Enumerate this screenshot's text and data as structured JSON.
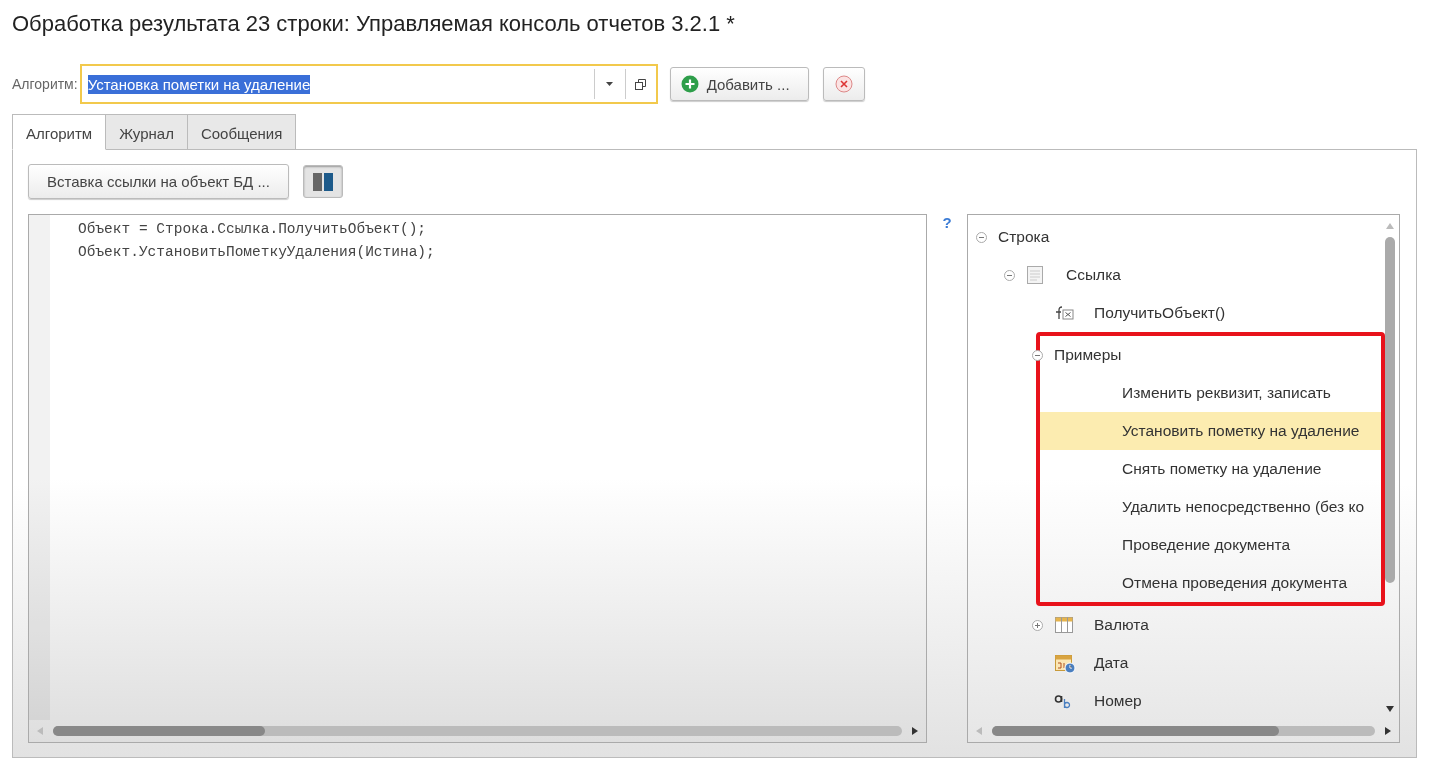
{
  "window": {
    "title": "Обработка результата 23 строки: Управляемая консоль отчетов 3.2.1 *"
  },
  "algorithm_field": {
    "label": "Алгоритм:",
    "value": "Установка пометки на удаление",
    "text_selected": true
  },
  "header_buttons": [
    {
      "kind": "add",
      "label": "Добавить ..."
    },
    {
      "kind": "delete"
    }
  ],
  "tabs": [
    {
      "label": "Алгоритм",
      "selected": true
    },
    {
      "label": "Журнал",
      "selected": false
    },
    {
      "label": "Сообщения",
      "selected": false
    }
  ],
  "toolbar": {
    "insert_button": "Вставка ссылки на объект БД ...",
    "layout_toggle": {
      "on": true
    }
  },
  "editor": {
    "lines": [
      "Объект = Строка.Ссылка.ПолучитьОбъект();",
      "Объект.УстановитьПометкуУдаления(Истина);"
    ]
  },
  "help_mark": "?",
  "tree": {
    "items": [
      {
        "label": "Строка",
        "expanded": true,
        "children": [
          {
            "label": "Ссылка",
            "kind": "document",
            "expanded": true,
            "children": [
              {
                "label": "ПолучитьОбъект()",
                "kind": "function"
              },
              {
                "label": "Примеры",
                "expanded": true,
                "highlighted": true,
                "children": [
                  {
                    "label": "Изменить реквизит, записать",
                    "selected": false
                  },
                  {
                    "label": "Установить пометку на удаление",
                    "selected": true
                  },
                  {
                    "label": "Снять пометку на удаление",
                    "selected": false
                  },
                  {
                    "label": "Удалить непосредственно (без ко",
                    "selected": false
                  },
                  {
                    "label": "Проведение документа",
                    "selected": false
                  },
                  {
                    "label": "Отмена проведения документа",
                    "selected": false
                  }
                ]
              },
              {
                "label": "Валюта",
                "kind": "table",
                "expanded": false
              },
              {
                "label": "Дата",
                "kind": "calendar"
              },
              {
                "label": "Номер",
                "kind": "string"
              }
            ]
          }
        ]
      }
    ]
  }
}
